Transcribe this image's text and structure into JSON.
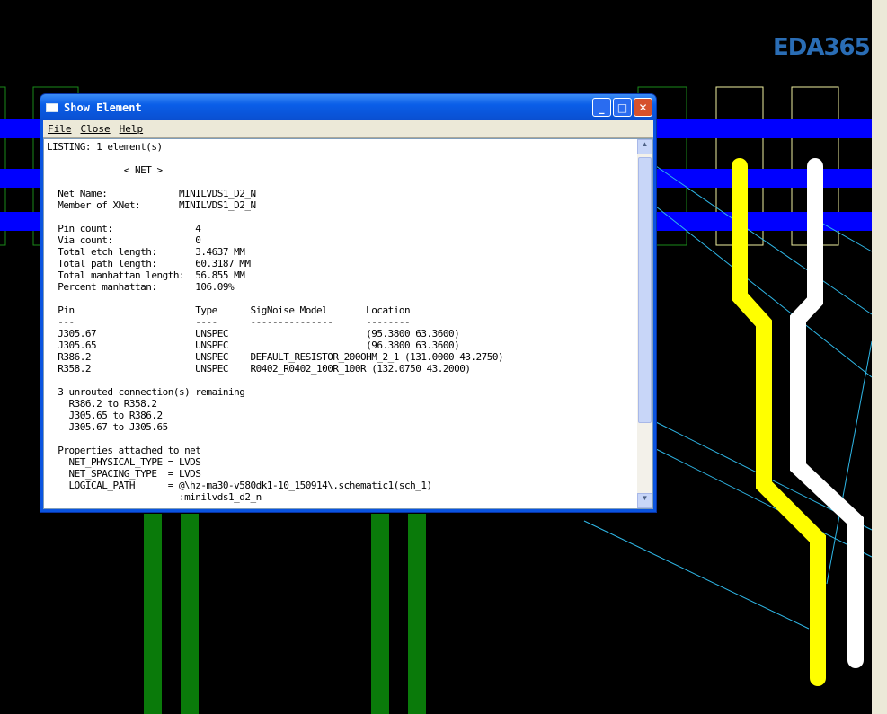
{
  "logo": "EDA365",
  "window": {
    "title": "Show Element",
    "menu": [
      "File",
      "Close",
      "Help"
    ]
  },
  "listing": [
    "LISTING: 1 element(s)",
    "",
    "              < NET >",
    "",
    "  Net Name:             MINILVDS1_D2_N",
    "  Member of XNet:       MINILVDS1_D2_N",
    "",
    "  Pin count:               4",
    "  Via count:               0",
    "  Total etch length:       3.4637 MM",
    "  Total path length:       60.3187 MM",
    "  Total manhattan length:  56.855 MM",
    "  Percent manhattan:       106.09%",
    "",
    "  Pin                      Type      SigNoise Model       Location",
    "  ---                      ----      ---------------      --------",
    "  J305.67                  UNSPEC                         (95.3800 63.3600)",
    "  J305.65                  UNSPEC                         (96.3800 63.3600)",
    "  R386.2                   UNSPEC    DEFAULT_RESISTOR_200OHM_2_1 (131.0000 43.2750)",
    "  R358.2                   UNSPEC    R0402_R0402_100R_100R (132.0750 43.2000)",
    "",
    "  3 unrouted connection(s) remaining",
    "    R386.2 to R358.2",
    "    J305.65 to R386.2",
    "    J305.67 to J305.65",
    "",
    "  Properties attached to net",
    "    NET_PHYSICAL_TYPE = LVDS",
    "    NET_SPACING_TYPE  = LVDS",
    "    LOGICAL_PATH      = @\\hz-ma30-v580dk1-10_150914\\.schematic1(sch_1)",
    "                        :minilvds1_d2_n"
  ]
}
